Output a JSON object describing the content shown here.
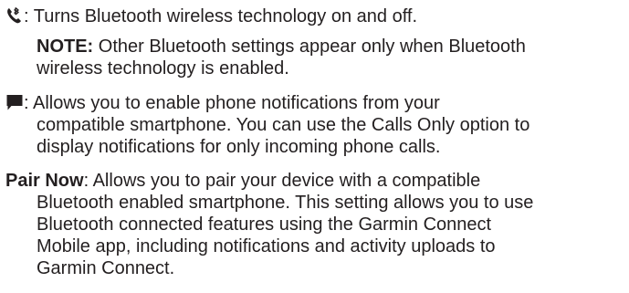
{
  "bluetooth_item": {
    "icon": "bluetooth-phone-icon",
    "line1": ": Turns Bluetooth wireless technology on and off.",
    "note_label": "NOTE:",
    "note_line1": " Other Bluetooth settings appear only when Bluetooth",
    "note_line2": "wireless technology is enabled."
  },
  "notifications_item": {
    "icon": "speech-bubble-icon",
    "line1": ": Allows you to enable phone notifications from your",
    "line2": "compatible smartphone. You can use the Calls Only option to",
    "line3": "display notifications for only incoming phone calls."
  },
  "pair_item": {
    "term": "Pair Now",
    "line1": ": Allows you to pair your device with a compatible",
    "line2": "Bluetooth enabled smartphone. This setting allows you to use",
    "line3": "Bluetooth connected features using the Garmin Connect",
    "line4": "Mobile app, including notifications and activity uploads to",
    "line5": "Garmin Connect."
  }
}
